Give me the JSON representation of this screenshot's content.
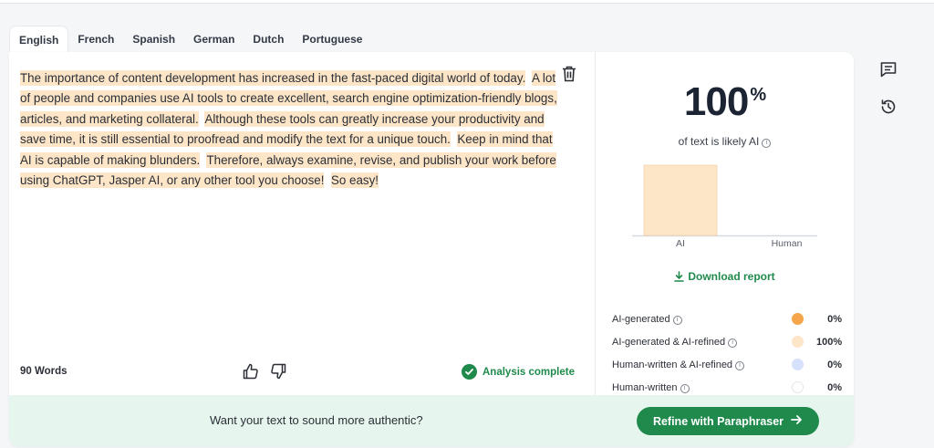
{
  "tabs": [
    {
      "label": "English",
      "active": true
    },
    {
      "label": "French"
    },
    {
      "label": "Spanish"
    },
    {
      "label": "German"
    },
    {
      "label": "Dutch"
    },
    {
      "label": "Portuguese"
    }
  ],
  "editor": {
    "sentences": [
      "The importance of content development has increased in the fast-paced digital world of today.",
      "A lot of people and companies use AI tools to create excellent, search engine optimization-friendly blogs, articles, and marketing collateral.",
      "Although these tools can greatly increase your productivity and save time, it is still essential to proofread and modify the text for a unique touch.",
      "Keep in mind that AI is capable of making blunders.",
      "Therefore, always examine, revise, and publish your work before using ChatGPT, Jasper AI, or any other tool you choose!",
      "So easy!"
    ],
    "word_count": "90 Words",
    "status": "Analysis complete"
  },
  "results": {
    "score_value": "100",
    "score_unit": "%",
    "caption": "of text is likely AI",
    "download_label": "Download report",
    "legend": [
      {
        "label": "AI-generated",
        "value": "0%",
        "color": "#f5a54a"
      },
      {
        "label": "AI-generated & AI-refined",
        "value": "100%",
        "color": "#fde5c8"
      },
      {
        "label": "Human-written & AI-refined",
        "value": "0%",
        "color": "#d6e2fb"
      },
      {
        "label": "Human-written",
        "value": "0%",
        "color": "#ffffff"
      }
    ]
  },
  "chart_data": {
    "type": "bar",
    "categories": [
      "AI",
      "Human"
    ],
    "values": [
      100,
      0
    ],
    "ylim": [
      0,
      100
    ],
    "grid": false,
    "bar_color": "#fde5c8"
  },
  "footer": {
    "prompt": "Want your text to sound more authentic?",
    "cta_label": "Refine with Paraphraser"
  },
  "colors": {
    "accent": "#1f8a4c",
    "highlight": "#fde5c8"
  }
}
